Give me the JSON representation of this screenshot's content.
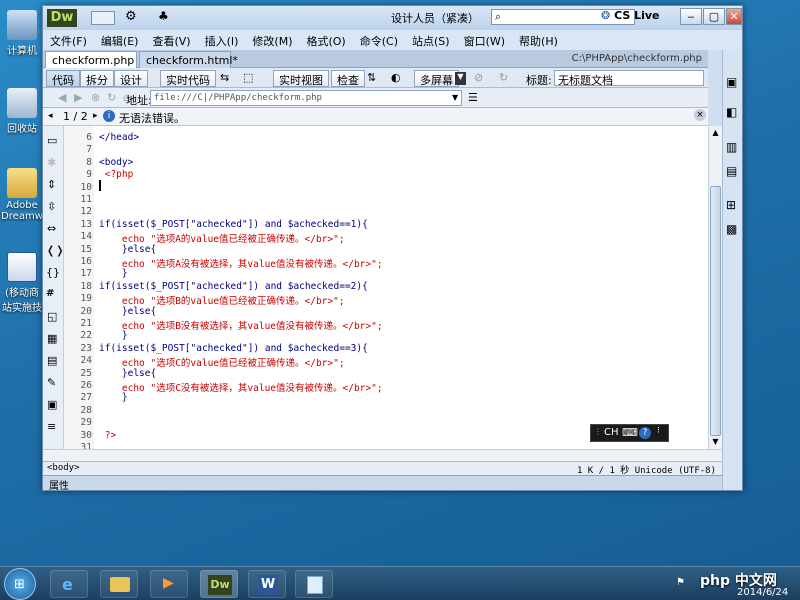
{
  "desktop": {
    "icons": [
      {
        "label": "计算机"
      },
      {
        "label": "回收站"
      },
      {
        "label": "Adobe Dreamw"
      },
      {
        "label": "(移动商 站实施技"
      }
    ]
  },
  "titlebar": {
    "logo": "Dw",
    "workspace": "设计人员（紧凑）",
    "cslive": "CS Live"
  },
  "menubar": [
    "文件(F)",
    "编辑(E)",
    "查看(V)",
    "插入(I)",
    "修改(M)",
    "格式(O)",
    "命令(C)",
    "站点(S)",
    "窗口(W)",
    "帮助(H)"
  ],
  "tabs": [
    {
      "label": "checkform.php"
    },
    {
      "label": "checkform.html*"
    }
  ],
  "filepath": "C:\\PHPApp\\checkform.php",
  "toolbar": {
    "code": "代码",
    "split": "拆分",
    "design": "设计",
    "livecode": "实时代码",
    "liveview": "实时视图",
    "inspect": "检查",
    "multiscreen": "多屏幕",
    "title_label": "标题:",
    "title_value": "无标题文档"
  },
  "address": {
    "label": "地址:",
    "value": "file:///C|/PHPApp/checkform.php"
  },
  "status": {
    "pager": "1 / 2",
    "message": "无语法错误。"
  },
  "code": {
    "line_numbers": [
      "6",
      "7",
      "8",
      "9",
      "10",
      "11",
      "12",
      "13",
      "14",
      "15",
      "16",
      "17",
      "18",
      "19",
      "20",
      "21",
      "22",
      "23",
      "24",
      "25",
      "26",
      "27",
      "28",
      "29",
      "30",
      "31"
    ],
    "lines": [
      "</head>",
      "",
      "<body>",
      " <?php",
      "",
      "",
      "",
      "if(isset($_POST[\"achecked\"]) and $achecked==1){",
      "    echo \"选项A的value值已经被正确传递。</br>\";",
      "    }else{",
      "    echo \"选项A没有被选择，其value值没有被传递。</br>\";",
      "    }",
      "if(isset($_POST[\"achecked\"]) and $achecked==2){",
      "    echo \"选项B的value值已经被正确传递。</br>\";",
      "    }else{",
      "    echo \"选项B没有被选择，其value值没有被传递。</br>\";",
      "    }",
      "if(isset($_POST[\"achecked\"]) and $achecked==3){",
      "    echo \"选项C的value值已经被正确传递。</br>\";",
      "    }else{",
      "    echo \"选项C没有被选择，其value值没有被传递。</br>\";",
      "    }",
      "",
      "",
      " ?>",
      ""
    ]
  },
  "bottom": {
    "tag": "<body>",
    "info": "1 K / 1 秒  Unicode (UTF-8)",
    "properties": "属性"
  },
  "ime": {
    "label": "CH"
  },
  "taskbar": {
    "clock_date": "2014/6/24",
    "watermark": "php 中文网"
  }
}
